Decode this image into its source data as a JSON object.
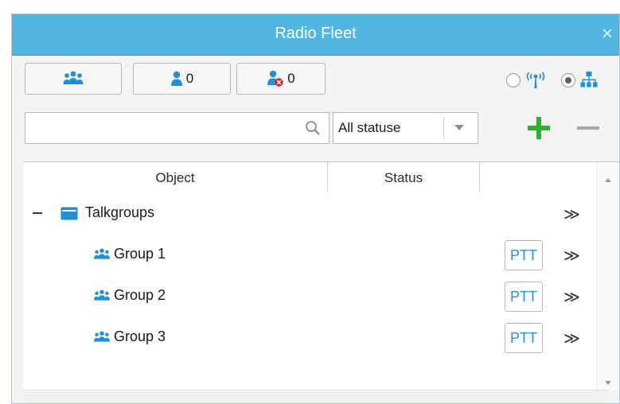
{
  "window": {
    "title": "Radio Fleet",
    "close_glyph": "×",
    "colors": {
      "titlebar": "#51b5e0",
      "accent_blue": "#1f8fd8",
      "add_green": "#2fae35",
      "alert_red": "#d9262c"
    }
  },
  "toolbar": {
    "groups_button": {
      "icon": "group-icon",
      "count": ""
    },
    "radios_button": {
      "icon": "user-icon",
      "count": "0"
    },
    "offline_radios_button": {
      "icon": "user-offline-icon",
      "count": "0"
    },
    "view_mode": {
      "options": [
        "radio-signal-icon",
        "network-tree-icon"
      ],
      "selected": "network-tree-icon"
    }
  },
  "filter": {
    "search_value": "",
    "search_icon": "search-icon",
    "status_selected": "All statuse",
    "add_icon": "plus-icon",
    "remove_icon": "minus-icon"
  },
  "grid": {
    "columns": [
      "Object",
      "Status",
      ""
    ],
    "folder": {
      "label": "Talkgroups",
      "expand_glyph": "≫"
    },
    "rows": [
      {
        "label": "Group 1",
        "ptt": "PTT",
        "expand_glyph": "≫"
      },
      {
        "label": "Group 2",
        "ptt": "PTT",
        "expand_glyph": "≫"
      },
      {
        "label": "Group 3",
        "ptt": "PTT",
        "expand_glyph": "≫"
      }
    ]
  }
}
